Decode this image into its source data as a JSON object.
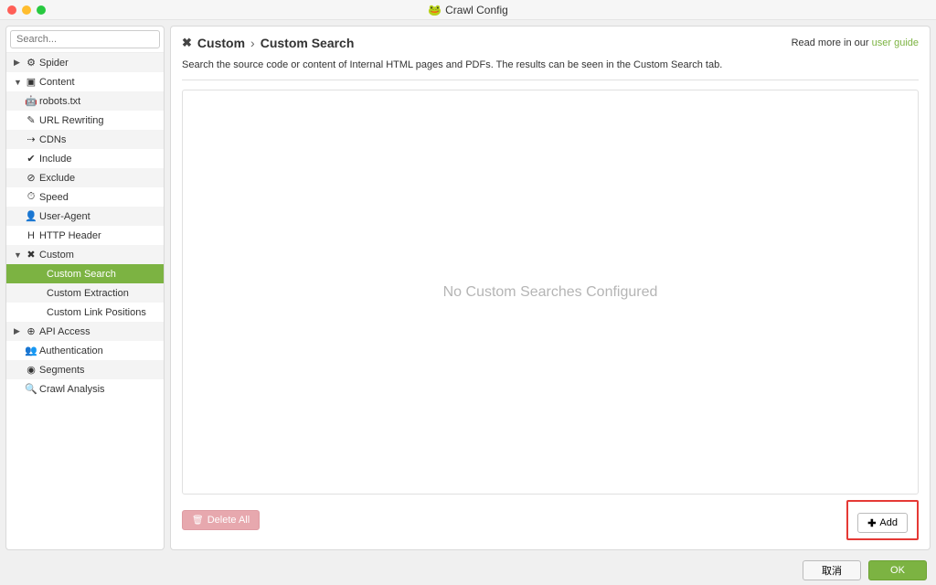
{
  "window": {
    "title": "Crawl Config"
  },
  "sidebar": {
    "search_placeholder": "Search...",
    "items": [
      {
        "label": "Spider",
        "icon": "⚙",
        "has_children": true,
        "expanded": false,
        "child": false
      },
      {
        "label": "Content",
        "icon": "▣",
        "has_children": true,
        "expanded": true,
        "child": false
      },
      {
        "label": "robots.txt",
        "icon": "🤖",
        "has_children": false,
        "child": false
      },
      {
        "label": "URL Rewriting",
        "icon": "✎",
        "has_children": false,
        "child": false
      },
      {
        "label": "CDNs",
        "icon": "⇢",
        "has_children": false,
        "child": false
      },
      {
        "label": "Include",
        "icon": "✔",
        "has_children": false,
        "child": false
      },
      {
        "label": "Exclude",
        "icon": "⊘",
        "has_children": false,
        "child": false
      },
      {
        "label": "Speed",
        "icon": "⏱",
        "has_children": false,
        "child": false
      },
      {
        "label": "User-Agent",
        "icon": "👤",
        "has_children": false,
        "child": false
      },
      {
        "label": "HTTP Header",
        "icon": "H",
        "has_children": false,
        "child": false
      },
      {
        "label": "Custom",
        "icon": "✖",
        "has_children": true,
        "expanded": true,
        "child": false
      },
      {
        "label": "Custom Search",
        "icon": "",
        "has_children": false,
        "child": true,
        "selected": true
      },
      {
        "label": "Custom Extraction",
        "icon": "",
        "has_children": false,
        "child": true
      },
      {
        "label": "Custom Link Positions",
        "icon": "",
        "has_children": false,
        "child": true
      },
      {
        "label": "API Access",
        "icon": "⊕",
        "has_children": true,
        "expanded": false,
        "child": false
      },
      {
        "label": "Authentication",
        "icon": "👥",
        "has_children": false,
        "child": false
      },
      {
        "label": "Segments",
        "icon": "◉",
        "has_children": false,
        "child": false
      },
      {
        "label": "Crawl Analysis",
        "icon": "🔍",
        "has_children": false,
        "child": false
      }
    ]
  },
  "main": {
    "breadcrumb": {
      "section": "Custom",
      "page": "Custom Search"
    },
    "readmore_text": "Read more in our ",
    "readmore_link": "user guide",
    "description": "Search the source code or content of Internal HTML pages and PDFs. The results can be seen in the Custom Search tab.",
    "empty_state": "No Custom Searches Configured",
    "delete_all": "Delete All",
    "add": "Add"
  },
  "footer": {
    "cancel": "取消",
    "ok": "OK"
  }
}
